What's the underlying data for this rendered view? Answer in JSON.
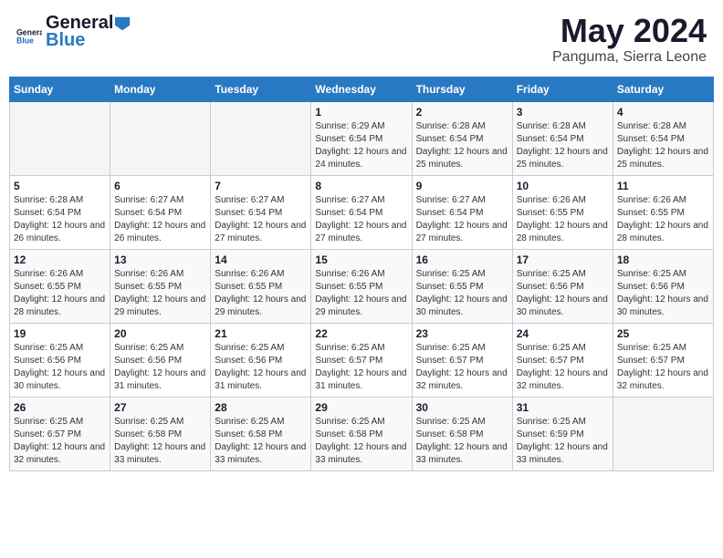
{
  "header": {
    "logo_general": "General",
    "logo_blue": "Blue",
    "title": "May 2024",
    "subtitle": "Panguma, Sierra Leone"
  },
  "calendar": {
    "days_of_week": [
      "Sunday",
      "Monday",
      "Tuesday",
      "Wednesday",
      "Thursday",
      "Friday",
      "Saturday"
    ],
    "weeks": [
      [
        {
          "day": "",
          "sunrise": "",
          "sunset": "",
          "daylight": "",
          "empty": true
        },
        {
          "day": "",
          "sunrise": "",
          "sunset": "",
          "daylight": "",
          "empty": true
        },
        {
          "day": "",
          "sunrise": "",
          "sunset": "",
          "daylight": "",
          "empty": true
        },
        {
          "day": "1",
          "sunrise": "Sunrise: 6:29 AM",
          "sunset": "Sunset: 6:54 PM",
          "daylight": "Daylight: 12 hours and 24 minutes.",
          "empty": false
        },
        {
          "day": "2",
          "sunrise": "Sunrise: 6:28 AM",
          "sunset": "Sunset: 6:54 PM",
          "daylight": "Daylight: 12 hours and 25 minutes.",
          "empty": false
        },
        {
          "day": "3",
          "sunrise": "Sunrise: 6:28 AM",
          "sunset": "Sunset: 6:54 PM",
          "daylight": "Daylight: 12 hours and 25 minutes.",
          "empty": false
        },
        {
          "day": "4",
          "sunrise": "Sunrise: 6:28 AM",
          "sunset": "Sunset: 6:54 PM",
          "daylight": "Daylight: 12 hours and 25 minutes.",
          "empty": false
        }
      ],
      [
        {
          "day": "5",
          "sunrise": "Sunrise: 6:28 AM",
          "sunset": "Sunset: 6:54 PM",
          "daylight": "Daylight: 12 hours and 26 minutes.",
          "empty": false
        },
        {
          "day": "6",
          "sunrise": "Sunrise: 6:27 AM",
          "sunset": "Sunset: 6:54 PM",
          "daylight": "Daylight: 12 hours and 26 minutes.",
          "empty": false
        },
        {
          "day": "7",
          "sunrise": "Sunrise: 6:27 AM",
          "sunset": "Sunset: 6:54 PM",
          "daylight": "Daylight: 12 hours and 27 minutes.",
          "empty": false
        },
        {
          "day": "8",
          "sunrise": "Sunrise: 6:27 AM",
          "sunset": "Sunset: 6:54 PM",
          "daylight": "Daylight: 12 hours and 27 minutes.",
          "empty": false
        },
        {
          "day": "9",
          "sunrise": "Sunrise: 6:27 AM",
          "sunset": "Sunset: 6:54 PM",
          "daylight": "Daylight: 12 hours and 27 minutes.",
          "empty": false
        },
        {
          "day": "10",
          "sunrise": "Sunrise: 6:26 AM",
          "sunset": "Sunset: 6:55 PM",
          "daylight": "Daylight: 12 hours and 28 minutes.",
          "empty": false
        },
        {
          "day": "11",
          "sunrise": "Sunrise: 6:26 AM",
          "sunset": "Sunset: 6:55 PM",
          "daylight": "Daylight: 12 hours and 28 minutes.",
          "empty": false
        }
      ],
      [
        {
          "day": "12",
          "sunrise": "Sunrise: 6:26 AM",
          "sunset": "Sunset: 6:55 PM",
          "daylight": "Daylight: 12 hours and 28 minutes.",
          "empty": false
        },
        {
          "day": "13",
          "sunrise": "Sunrise: 6:26 AM",
          "sunset": "Sunset: 6:55 PM",
          "daylight": "Daylight: 12 hours and 29 minutes.",
          "empty": false
        },
        {
          "day": "14",
          "sunrise": "Sunrise: 6:26 AM",
          "sunset": "Sunset: 6:55 PM",
          "daylight": "Daylight: 12 hours and 29 minutes.",
          "empty": false
        },
        {
          "day": "15",
          "sunrise": "Sunrise: 6:26 AM",
          "sunset": "Sunset: 6:55 PM",
          "daylight": "Daylight: 12 hours and 29 minutes.",
          "empty": false
        },
        {
          "day": "16",
          "sunrise": "Sunrise: 6:25 AM",
          "sunset": "Sunset: 6:55 PM",
          "daylight": "Daylight: 12 hours and 30 minutes.",
          "empty": false
        },
        {
          "day": "17",
          "sunrise": "Sunrise: 6:25 AM",
          "sunset": "Sunset: 6:56 PM",
          "daylight": "Daylight: 12 hours and 30 minutes.",
          "empty": false
        },
        {
          "day": "18",
          "sunrise": "Sunrise: 6:25 AM",
          "sunset": "Sunset: 6:56 PM",
          "daylight": "Daylight: 12 hours and 30 minutes.",
          "empty": false
        }
      ],
      [
        {
          "day": "19",
          "sunrise": "Sunrise: 6:25 AM",
          "sunset": "Sunset: 6:56 PM",
          "daylight": "Daylight: 12 hours and 30 minutes.",
          "empty": false
        },
        {
          "day": "20",
          "sunrise": "Sunrise: 6:25 AM",
          "sunset": "Sunset: 6:56 PM",
          "daylight": "Daylight: 12 hours and 31 minutes.",
          "empty": false
        },
        {
          "day": "21",
          "sunrise": "Sunrise: 6:25 AM",
          "sunset": "Sunset: 6:56 PM",
          "daylight": "Daylight: 12 hours and 31 minutes.",
          "empty": false
        },
        {
          "day": "22",
          "sunrise": "Sunrise: 6:25 AM",
          "sunset": "Sunset: 6:57 PM",
          "daylight": "Daylight: 12 hours and 31 minutes.",
          "empty": false
        },
        {
          "day": "23",
          "sunrise": "Sunrise: 6:25 AM",
          "sunset": "Sunset: 6:57 PM",
          "daylight": "Daylight: 12 hours and 32 minutes.",
          "empty": false
        },
        {
          "day": "24",
          "sunrise": "Sunrise: 6:25 AM",
          "sunset": "Sunset: 6:57 PM",
          "daylight": "Daylight: 12 hours and 32 minutes.",
          "empty": false
        },
        {
          "day": "25",
          "sunrise": "Sunrise: 6:25 AM",
          "sunset": "Sunset: 6:57 PM",
          "daylight": "Daylight: 12 hours and 32 minutes.",
          "empty": false
        }
      ],
      [
        {
          "day": "26",
          "sunrise": "Sunrise: 6:25 AM",
          "sunset": "Sunset: 6:57 PM",
          "daylight": "Daylight: 12 hours and 32 minutes.",
          "empty": false
        },
        {
          "day": "27",
          "sunrise": "Sunrise: 6:25 AM",
          "sunset": "Sunset: 6:58 PM",
          "daylight": "Daylight: 12 hours and 33 minutes.",
          "empty": false
        },
        {
          "day": "28",
          "sunrise": "Sunrise: 6:25 AM",
          "sunset": "Sunset: 6:58 PM",
          "daylight": "Daylight: 12 hours and 33 minutes.",
          "empty": false
        },
        {
          "day": "29",
          "sunrise": "Sunrise: 6:25 AM",
          "sunset": "Sunset: 6:58 PM",
          "daylight": "Daylight: 12 hours and 33 minutes.",
          "empty": false
        },
        {
          "day": "30",
          "sunrise": "Sunrise: 6:25 AM",
          "sunset": "Sunset: 6:58 PM",
          "daylight": "Daylight: 12 hours and 33 minutes.",
          "empty": false
        },
        {
          "day": "31",
          "sunrise": "Sunrise: 6:25 AM",
          "sunset": "Sunset: 6:59 PM",
          "daylight": "Daylight: 12 hours and 33 minutes.",
          "empty": false
        },
        {
          "day": "",
          "sunrise": "",
          "sunset": "",
          "daylight": "",
          "empty": true
        }
      ]
    ]
  }
}
